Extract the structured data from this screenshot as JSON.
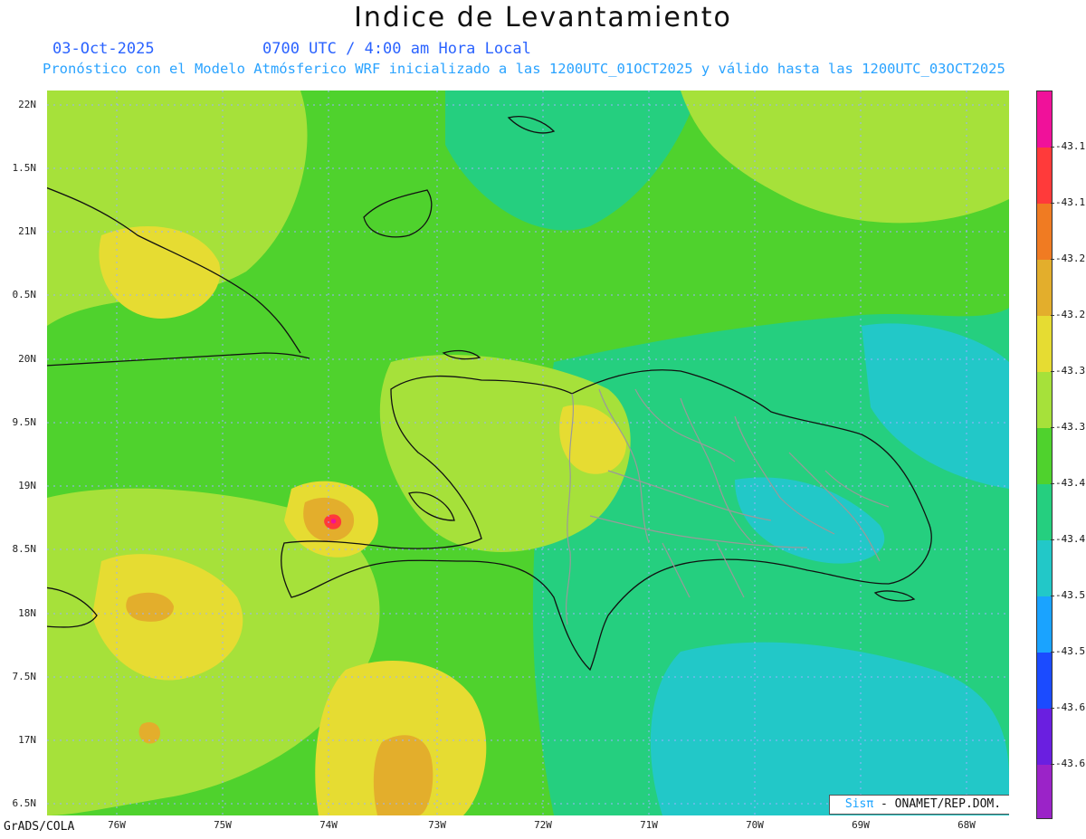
{
  "title": "Indice de Levantamiento",
  "date": "03-Oct-2025",
  "time": "0700 UTC / 4:00 am Hora Local",
  "subtitle": "Pronóstico con el Modelo Atmósferico WRF inicializado a las 1200UTC_01OCT2025 y válido hasta las  1200UTC_03OCT2025",
  "footer_left": "GrADS/COLA",
  "credit": {
    "sis": "Sisπ",
    "rest": " - ONAMET/REP.DOM."
  },
  "lat_labels": [
    "22N",
    "1.5N",
    "21N",
    "0.5N",
    "20N",
    "9.5N",
    "19N",
    "8.5N",
    "18N",
    "7.5N",
    "17N",
    "6.5N"
  ],
  "lon_labels": [
    "76W",
    "75W",
    "74W",
    "73W",
    "72W",
    "71W",
    "70W",
    "69W",
    "68W"
  ],
  "colorbar": {
    "colors": [
      "#f0119a",
      "#ff3a3a",
      "#f07b22",
      "#e3ae2c",
      "#e6dc32",
      "#a6e13a",
      "#4fd22d",
      "#25cf7f",
      "#22c8c8",
      "#1aa3ff",
      "#1b4bff",
      "#6a1fe0",
      "#9b23c8"
    ],
    "labels": [
      "-43.1",
      "-43.1",
      "-43.2",
      "-43.2",
      "-43.3",
      "-43.3",
      "-43.4",
      "-43.4",
      "-43.5",
      "-43.5",
      "-43.6",
      "-43.6"
    ]
  }
}
